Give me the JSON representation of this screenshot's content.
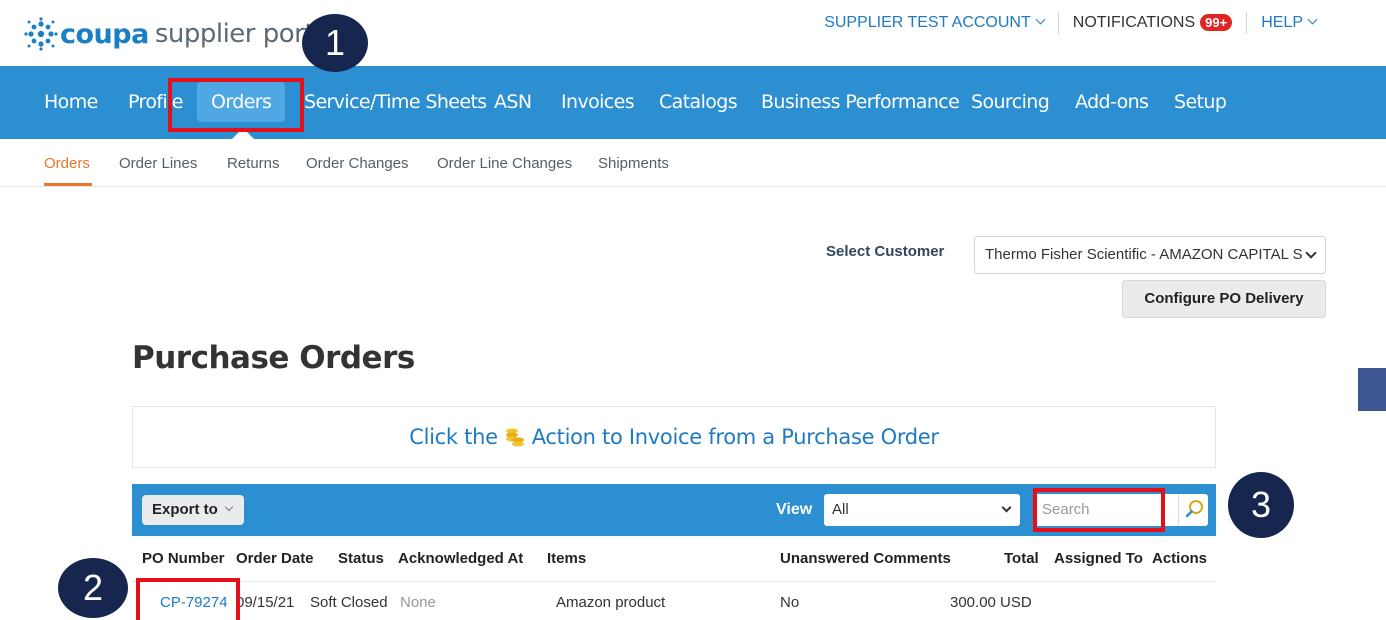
{
  "header": {
    "logo_brand": "coupa",
    "logo_sub": "supplier portal",
    "account_label": "SUPPLIER TEST ACCOUNT",
    "notifications_label": "NOTIFICATIONS",
    "notifications_badge": "99+",
    "help_label": "HELP"
  },
  "nav": {
    "items": [
      "Home",
      "Profile",
      "Orders",
      "Service/Time Sheets",
      "ASN",
      "Invoices",
      "Catalogs",
      "Business Performance",
      "Sourcing",
      "Add-ons",
      "Setup"
    ],
    "active": "Orders"
  },
  "subnav": {
    "items": [
      "Orders",
      "Order Lines",
      "Returns",
      "Order Changes",
      "Order Line Changes",
      "Shipments"
    ],
    "active": "Orders"
  },
  "customer": {
    "label": "Select Customer",
    "selected": "Thermo Fisher Scientific - AMAZON CAPITAL S",
    "configure_button": "Configure PO Delivery"
  },
  "page_title": "Purchase Orders",
  "info": {
    "prefix": "Click the",
    "suffix": "Action to Invoice from a Purchase Order",
    "icon": "coins-icon"
  },
  "toolbar": {
    "export_label": "Export to",
    "view_label": "View",
    "view_selected": "All",
    "search_placeholder": "Search"
  },
  "table": {
    "columns": [
      "PO Number",
      "Order Date",
      "Status",
      "Acknowledged At",
      "Items",
      "Unanswered Comments",
      "Total",
      "Assigned To",
      "Actions"
    ],
    "rows": [
      {
        "po_number": "CP-79274",
        "order_date": "09/15/21",
        "status": "Soft Closed",
        "acknowledged_at": "None",
        "items": "Amazon product",
        "unanswered_comments": "No",
        "total": "300.00 USD",
        "assigned_to": "",
        "actions": ""
      }
    ]
  },
  "annotations": {
    "callout_1": "1",
    "callout_2": "2",
    "callout_3": "3",
    "color": "#16264e",
    "highlight_color": "#e3101a"
  },
  "colors": {
    "brand_blue": "#2b8fd2",
    "link_blue": "#1e7bc3",
    "active_orange": "#e8762b",
    "badge_red": "#e02323"
  }
}
